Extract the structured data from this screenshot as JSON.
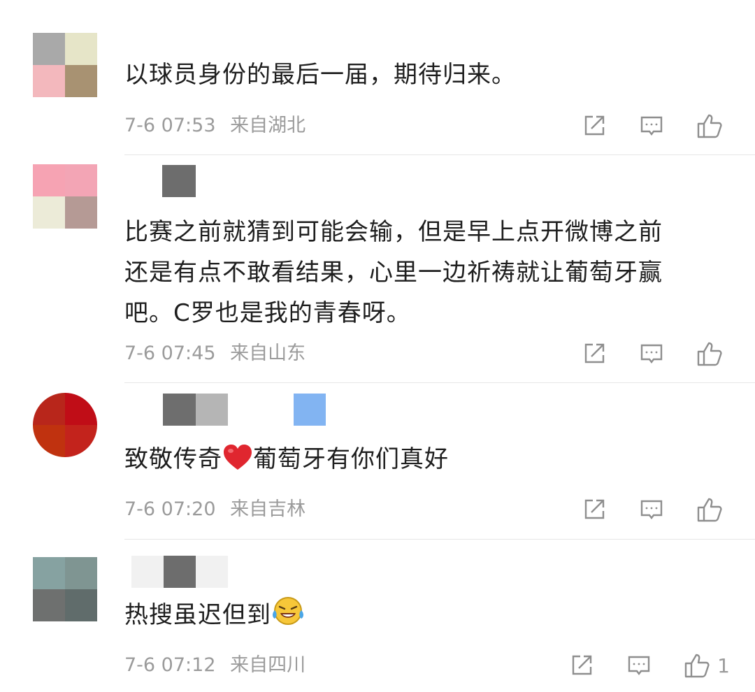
{
  "comments": [
    {
      "text": "以球员身份的最后一届，期待归来。",
      "time": "7-6 07:53",
      "location": "来自湖北",
      "likes": "",
      "avatar_colors": [
        "#a9a9a9",
        "#e6e5c8",
        "#f3b8bd",
        "#a89272"
      ],
      "name_blocks": []
    },
    {
      "text_lines": [
        "比赛之前就猜到可能会输，但是早上点开微博之前",
        "还是有点不敢看结果，心里一边祈祷就让葡萄牙赢",
        "吧。C罗也是我的青春呀。"
      ],
      "time": "7-6 07:45",
      "location": "来自山东",
      "likes": "",
      "avatar_colors": [
        "#f6a3b3",
        "#f3a5b5",
        "#ecebd8",
        "#b59a95"
      ],
      "name_blocks": [
        "#6d6d6d"
      ]
    },
    {
      "text_before_emoji": "致敬传奇",
      "text_after_emoji": "葡萄牙有你们真好",
      "emoji": "red-heart",
      "time": "7-6 07:20",
      "location": "来自吉林",
      "likes": "",
      "avatar_colors": [
        "#b8261b",
        "#c00d17",
        "#c0320f",
        "#c3231c"
      ],
      "name_blocks": [
        "#6e6e6e",
        "#b5b5b5",
        "#82b4f2"
      ]
    },
    {
      "text_before_emoji": "热搜虽迟但到",
      "emoji": "laughing-crying-face",
      "time": "7-6 07:12",
      "location": "来自四川",
      "likes": "1",
      "avatar_colors": [
        "#86a2a1",
        "#7f9592",
        "#6e706f",
        "#606c6b"
      ],
      "name_blocks": [
        "#6d6d6d"
      ]
    }
  ],
  "icons": {
    "share": "share-icon",
    "comment": "comment-icon",
    "like": "thumbs-up-icon"
  },
  "colors": {
    "meta": "#9b9b9b",
    "text": "#1e1e1e",
    "heart": "#e0262f",
    "emoji_face": "#f7c739"
  }
}
